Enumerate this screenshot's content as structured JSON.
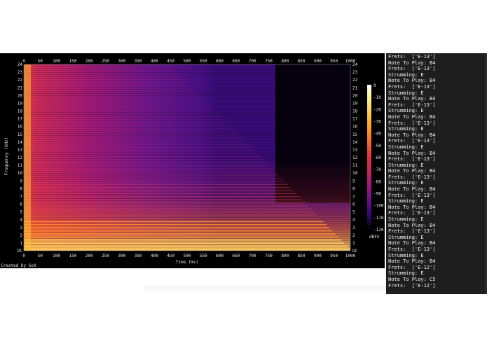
{
  "spectrogram": {
    "y_axis_label": "Frequency (kHz)",
    "x_axis_label": "Time (ms)",
    "credit": "Created by SoX",
    "colorbar_unit": "dBFS",
    "colorbar_ticks": [
      "0",
      "-10",
      "-20",
      "-30",
      "-40",
      "-50",
      "-60",
      "-70",
      "-80",
      "-90",
      "-100",
      "-110",
      "-120"
    ],
    "x_ticks": [
      "0",
      "50",
      "100",
      "150",
      "200",
      "250",
      "300",
      "350",
      "400",
      "450",
      "500",
      "550",
      "600",
      "650",
      "700",
      "750",
      "800",
      "850",
      "900",
      "950",
      "1000"
    ],
    "y_ticks": [
      "DC",
      "1",
      "2",
      "3",
      "4",
      "5",
      "6",
      "7",
      "8",
      "9",
      "10",
      "11",
      "12",
      "13",
      "14",
      "15",
      "16",
      "17",
      "18",
      "19",
      "20",
      "21",
      "22",
      "23",
      "24"
    ],
    "colors": {
      "background": "#000000",
      "hot": "#ffe36a",
      "warm": "#ff7a1a",
      "mid": "#d02a60",
      "cool": "#5a1590",
      "cold": "#26065c",
      "text": "#e6e6e6"
    }
  },
  "terminal": {
    "lines": [
      "Frets:  ['E-13']",
      "Note To Play: B4",
      "Frets:  ['E-13']",
      "Strumming: E",
      "Note To Play: B4",
      "Frets:  ['E-13']",
      "Strumming: E",
      "Note To Play: B4",
      "Frets:  ['E-13']",
      "Strumming: E",
      "Note To Play: B4",
      "Frets:  ['E-13']",
      "Strumming: E",
      "Note To Play: B4",
      "Frets:  ['E-13']",
      "Strumming: E",
      "Note To Play: B4",
      "Frets:  ['E-13']",
      "Strumming: E",
      "Note To Play: B4",
      "Frets:  ['E-13']",
      "Strumming: E",
      "Note To Play: B4",
      "Frets:  ['E-13']",
      "Strumming: E",
      "Note To Play: B4",
      "Frets:  ['E-13']",
      "Strumming: E",
      "Note To Play: B4",
      "Frets:  ['E-13']",
      "Strumming: E",
      "Note To Play: B4",
      "Frets:  ['E-13']",
      "Strumming: E",
      "Note To Play: B4",
      "Frets:  ['E-12']",
      "Strumming: E",
      "Note To Play: C5",
      "Frets:  ['E-12']"
    ]
  }
}
